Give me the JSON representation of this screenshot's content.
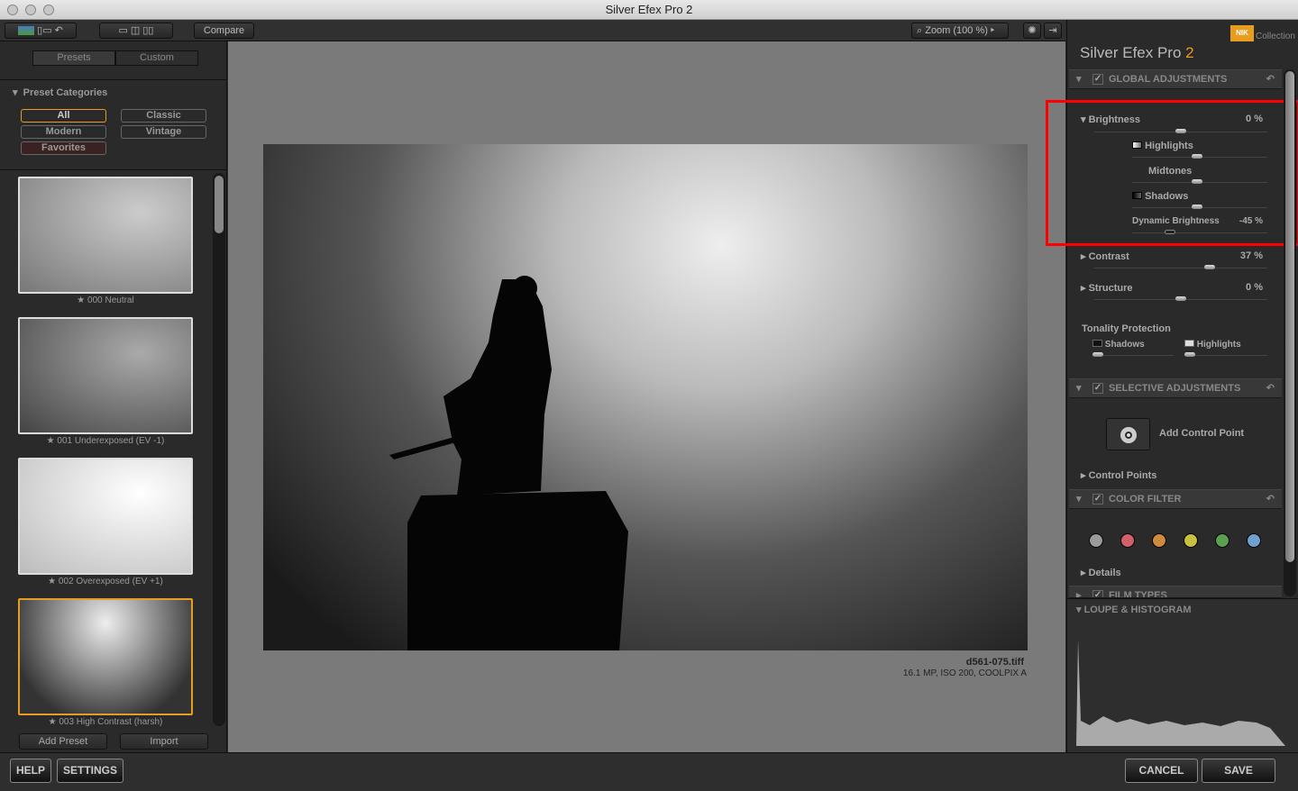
{
  "window": {
    "title": "Silver Efex Pro 2"
  },
  "toolbar": {
    "compare": "Compare",
    "zoom": "Zoom (100 %)"
  },
  "left": {
    "tabs": [
      "Presets",
      "Custom"
    ],
    "categories_title": "Preset Categories",
    "categories": [
      "All",
      "Classic",
      "Modern",
      "Vintage",
      "Favorites"
    ],
    "presets": [
      "★ 000 Neutral",
      "★ 001 Underexposed (EV -1)",
      "★ 002 Overexposed (EV +1)",
      "★ 003 High Contrast (harsh)"
    ],
    "add_preset": "Add Preset",
    "import": "Import"
  },
  "image": {
    "filename": "d561-075.tiff",
    "info": "16.1 MP, ISO 200, COOLPIX A"
  },
  "right": {
    "brand": "Collection",
    "brand_logo": "NIK",
    "product": "Silver Efex Pro",
    "version": "2",
    "global": "GLOBAL ADJUSTMENTS",
    "brightness": {
      "label": "Brightness",
      "value": "0 %",
      "highlights": "Highlights",
      "midtones": "Midtones",
      "shadows": "Shadows",
      "dynamic": "Dynamic Brightness",
      "dynamic_value": "-45 %"
    },
    "contrast": {
      "label": "Contrast",
      "value": "37 %"
    },
    "structure": {
      "label": "Structure",
      "value": "0 %"
    },
    "tonality": {
      "label": "Tonality Protection",
      "shadows": "Shadows",
      "highlights": "Highlights"
    },
    "selective": "SELECTIVE ADJUSTMENTS",
    "add_cp": "Add Control Point",
    "control_points": "Control Points",
    "color_filter": "COLOR FILTER",
    "filter_colors": [
      "#9a9a9a",
      "#d0606a",
      "#d08a3c",
      "#c8c040",
      "#5aa050",
      "#70a0d0"
    ],
    "details": "Details",
    "film_types": "FILM TYPES",
    "loupe": "LOUPE & HISTOGRAM"
  },
  "bottom": {
    "help": "HELP",
    "settings": "SETTINGS",
    "cancel": "CANCEL",
    "save": "SAVE"
  },
  "accent": "#e89d1e",
  "highlight_box": "#ff0000"
}
